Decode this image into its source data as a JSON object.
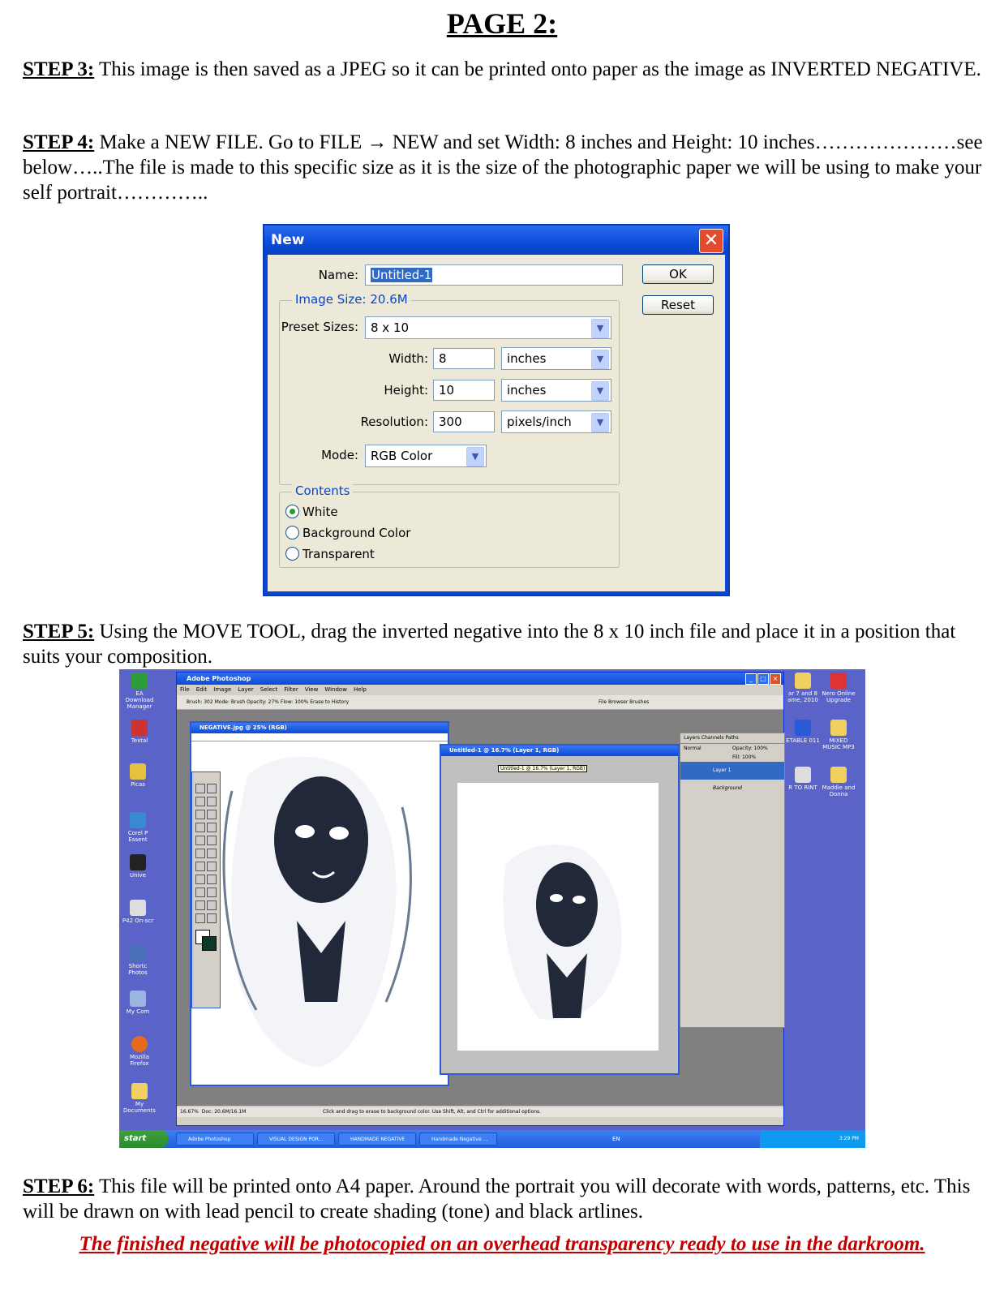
{
  "page_title": "PAGE 2:",
  "step3": {
    "label": "STEP 3:",
    "text": " This image is then saved as a JPEG so it can be printed onto paper as the image as INVERTED NEGATIVE."
  },
  "step4": {
    "label": "STEP 4:",
    "text": " Make a NEW FILE. Go to FILE → NEW and set Width: 8 inches  and Height: 10 inches…………………see below…..The file is made to this specific size as it is the size of the photographic paper we will be using to make your self portrait………….."
  },
  "step5": {
    "label": "STEP 5:",
    "text": " Using the MOVE TOOL, drag the inverted negative into the 8 x 10 inch file and place it in a position that suits your composition."
  },
  "step6": {
    "label": "STEP 6:",
    "text": " This file will be printed onto A4 paper. Around the portrait you will decorate with words, patterns, etc. This will be drawn on with lead pencil to create shading (tone) and black artlines."
  },
  "warning": "The finished negative will be photocopied on an overhead transparency ready to use in the darkroom.",
  "dialog": {
    "title": "New",
    "close": "✕",
    "name_label": "Name:",
    "name_value": "Untitled-1",
    "image_size": "Image Size: 20.6M",
    "preset_label": "Preset Sizes:",
    "preset_value": "8 x 10",
    "width_label": "Width:",
    "width_value": "8",
    "width_unit": "inches",
    "height_label": "Height:",
    "height_value": "10",
    "height_unit": "inches",
    "res_label": "Resolution:",
    "res_value": "300",
    "res_unit": "pixels/inch",
    "mode_label": "Mode:",
    "mode_value": "RGB Color",
    "contents_label": "Contents",
    "contents": [
      "White",
      "Background Color",
      "Transparent"
    ],
    "ok": "OK",
    "reset": "Reset"
  },
  "screenshot": {
    "desktop_icons": [
      "EA Download Manager",
      "Textal",
      "Picas",
      "Corel P Essent",
      "Unive",
      "P42 On-scr",
      "Shortc Photos",
      "My Com",
      "Mozilla Firefox",
      "My Documents"
    ],
    "right_icons": [
      "ar 7 and 8 ame, 2010",
      "Nero Online Upgrade",
      "ETABLE 011",
      "MIXED MUSIC MP3",
      "R TO RINT",
      "Maddie and Donna"
    ],
    "ps_title": "Adobe Photoshop",
    "menu": [
      "File",
      "Edit",
      "Image",
      "Layer",
      "Select",
      "Filter",
      "View",
      "Window",
      "Help"
    ],
    "options": "Brush:  302   Mode: Brush   Opacity: 27%   Flow: 100%   Erase to History",
    "palette_tabs": "File Browser   Brushes",
    "doc1_title": "NEGATIVE.jpg @ 25% (RGB)",
    "doc2_title": "Untitled-1 @ 16.7% (Layer 1, RGB)",
    "doc2_tip": "Untitled-1 @ 16.7% (Layer 1, RGB)",
    "layers_tabs": "Layers   Channels   Paths",
    "layers_mode": "Normal",
    "layers_opacity": "Opacity: 100%",
    "layers_fill": "Fill: 100%",
    "layer1": "Layer 1",
    "layer_bg": "Background",
    "status_zoom": "16.67%",
    "status_doc": "Doc: 20.6M/16.1M",
    "status_hint": "Click and drag to erase to background color. Use Shift, Alt, and Ctrl for additional options.",
    "start": "start",
    "taskbar_items": [
      "Adobe Photoshop",
      "VISUAL DESIGN POR...",
      "HANDMADE NEGATIVE",
      "Handmade Negative ..."
    ],
    "lang": "EN",
    "clock": "3:29 PM"
  }
}
